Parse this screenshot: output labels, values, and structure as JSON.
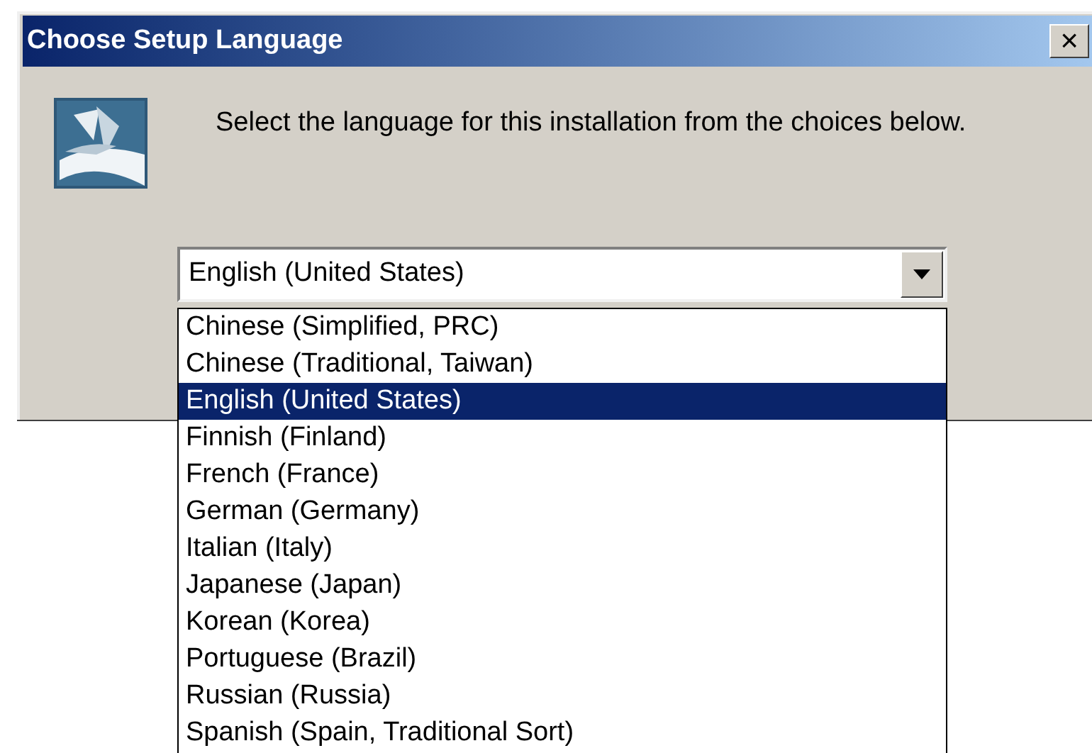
{
  "window": {
    "title": "Choose Setup Language",
    "close": "×"
  },
  "message": "Select the language for this installation from the choices below.",
  "combo": {
    "value": "English (United States)",
    "expanded": true
  },
  "options": [
    {
      "label": "Chinese (Simplified, PRC)",
      "selected": false
    },
    {
      "label": "Chinese (Traditional, Taiwan)",
      "selected": false
    },
    {
      "label": "English (United States)",
      "selected": true
    },
    {
      "label": "Finnish (Finland)",
      "selected": false
    },
    {
      "label": "French (France)",
      "selected": false
    },
    {
      "label": "German (Germany)",
      "selected": false
    },
    {
      "label": "Italian (Italy)",
      "selected": false
    },
    {
      "label": "Japanese (Japan)",
      "selected": false
    },
    {
      "label": "Korean (Korea)",
      "selected": false
    },
    {
      "label": "Portuguese (Brazil)",
      "selected": false
    },
    {
      "label": "Russian (Russia)",
      "selected": false
    },
    {
      "label": "Spanish (Spain, Traditional Sort)",
      "selected": false
    }
  ]
}
